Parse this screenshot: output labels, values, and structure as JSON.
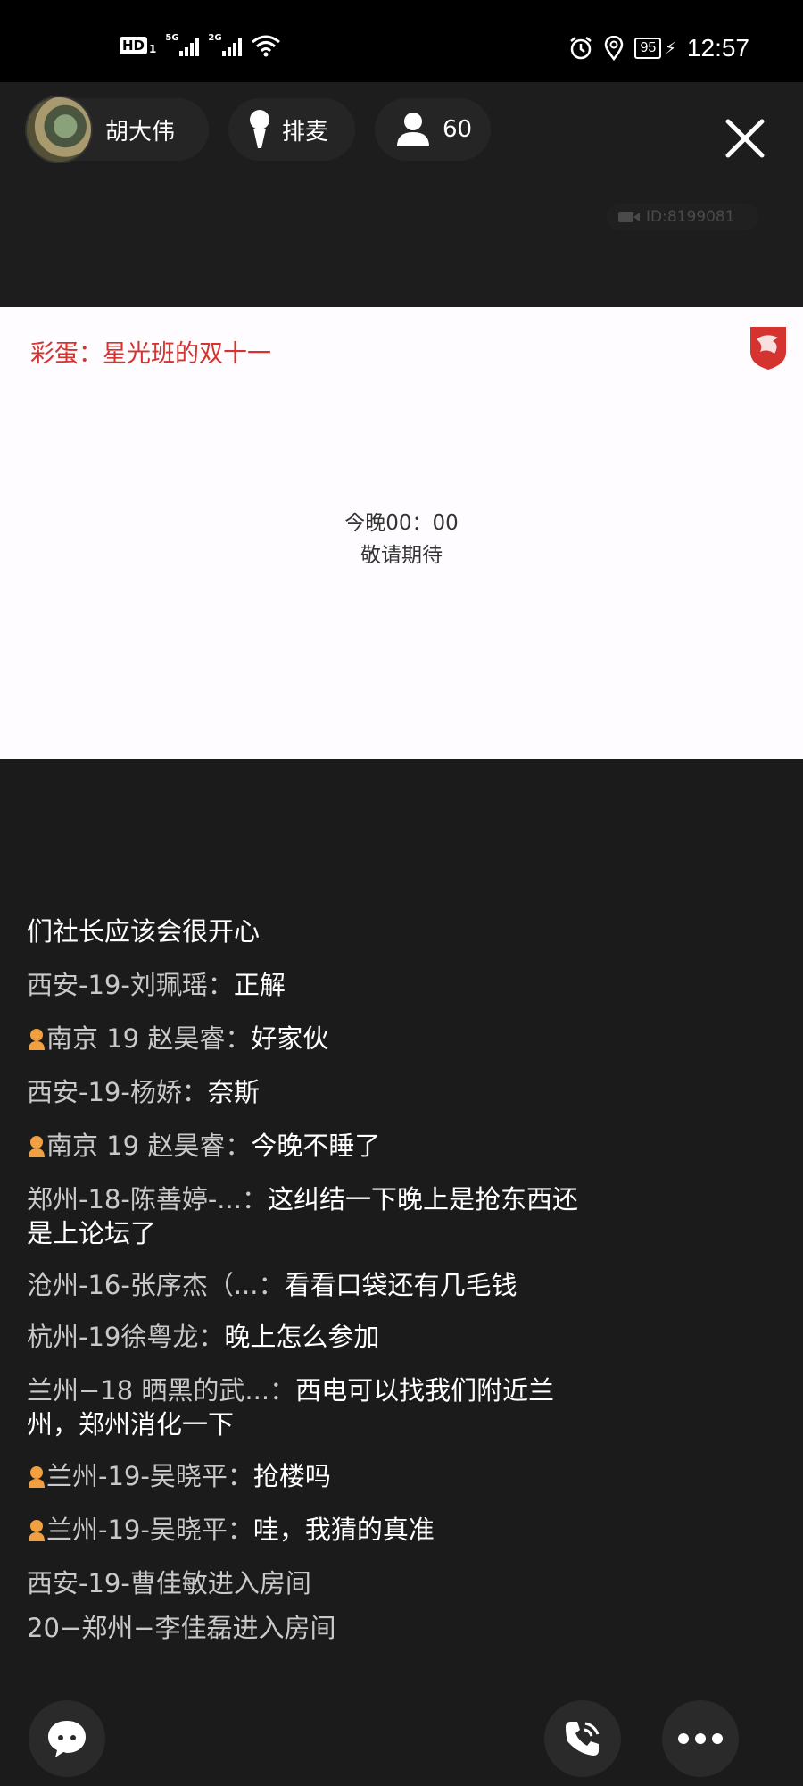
{
  "status_bar": {
    "network_badge": "HD",
    "network_sub": "1",
    "sim1_tag": "5G",
    "sim2_tag": "2G",
    "battery": "95",
    "time": "12:57"
  },
  "header": {
    "host_name": "胡大伟",
    "queue_label": "排麦",
    "audience_count": "60",
    "room_id": "ID:8199081"
  },
  "board": {
    "title": "彩蛋：星光班的双十一",
    "line1": "今晚00：00",
    "line2": "敬请期待",
    "brand_color": "#d4332f"
  },
  "chat": {
    "messages": [
      {
        "user": "",
        "text": "们社长应该会很开心",
        "badge": false
      },
      {
        "user": "西安-19-刘珮瑶：",
        "text": "正解",
        "badge": false
      },
      {
        "user": "南京 19 赵昊睿：",
        "text": "好家伙",
        "badge": true
      },
      {
        "user": "西安-19-杨娇：",
        "text": "奈斯",
        "badge": false
      },
      {
        "user": "南京 19 赵昊睿：",
        "text": "今晚不睡了",
        "badge": true
      },
      {
        "user": "郑州-18-陈善婷-...：",
        "text": "这纠结一下晚上是抢东西还是上论坛了",
        "badge": false
      },
      {
        "user": "沧州-16-张序杰（...：",
        "text": "看看口袋还有几毛钱",
        "badge": false
      },
      {
        "user": "杭州-19徐粤龙：",
        "text": "晚上怎么参加",
        "badge": false
      },
      {
        "user": "兰州−18 晒黑的武...：",
        "text": "西电可以找我们附近兰州，郑州消化一下",
        "badge": false
      },
      {
        "user": "兰州-19-吴晓平：",
        "text": "抢楼吗",
        "badge": true
      },
      {
        "user": "兰州-19-吴晓平：",
        "text": "哇，我猜的真准",
        "badge": true
      },
      {
        "user": "西安-19-曹佳敏进入房间",
        "text": "",
        "badge": false
      },
      {
        "user": "20−郑州−李佳磊进入房间",
        "text": "",
        "badge": false
      }
    ]
  }
}
